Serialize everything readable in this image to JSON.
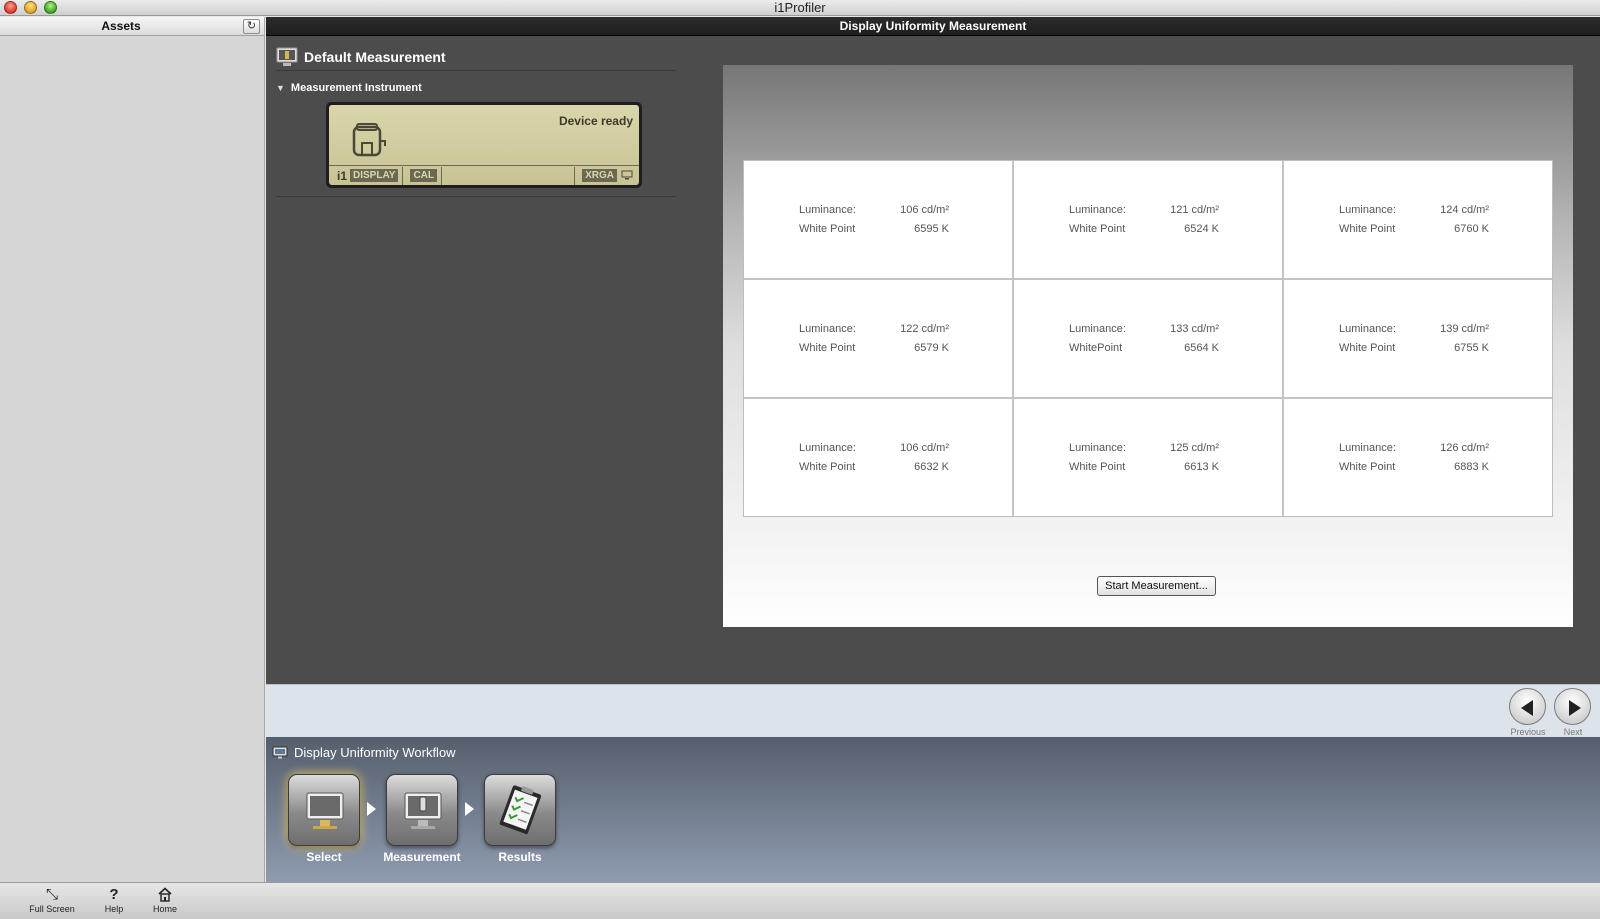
{
  "window": {
    "title": "i1Profiler"
  },
  "sidebar": {
    "title": "Assets",
    "refresh_icon": "↻"
  },
  "main": {
    "header_title": "Display Uniformity Measurement",
    "section_title": "Default Measurement",
    "instrument": {
      "title": "Measurement Instrument",
      "status": "Device ready",
      "tags": [
        "DISPLAY",
        "CAL",
        "XRGA"
      ],
      "logo": "i1"
    },
    "measurements": [
      {
        "lum_label": "Luminance:",
        "lum_value": "106 cd/m²",
        "wp_label": "White Point",
        "wp_value": "6595 K"
      },
      {
        "lum_label": "Luminance:",
        "lum_value": "121 cd/m²",
        "wp_label": "White Point",
        "wp_value": "6524 K"
      },
      {
        "lum_label": "Luminance:",
        "lum_value": "124 cd/m²",
        "wp_label": "White Point",
        "wp_value": "6760 K"
      },
      {
        "lum_label": "Luminance:",
        "lum_value": "122 cd/m²",
        "wp_label": "White Point",
        "wp_value": "6579 K"
      },
      {
        "lum_label": "Luminance:",
        "lum_value": "133 cd/m²",
        "wp_label": "WhitePoint",
        "wp_value": "6564 K"
      },
      {
        "lum_label": "Luminance:",
        "lum_value": "139 cd/m²",
        "wp_label": "White Point",
        "wp_value": "6755 K"
      },
      {
        "lum_label": "Luminance:",
        "lum_value": "106 cd/m²",
        "wp_label": "White Point",
        "wp_value": "6632 K"
      },
      {
        "lum_label": "Luminance:",
        "lum_value": "125 cd/m²",
        "wp_label": "White Point",
        "wp_value": "6613 K"
      },
      {
        "lum_label": "Luminance:",
        "lum_value": "126 cd/m²",
        "wp_label": "White Point",
        "wp_value": "6883 K"
      }
    ],
    "start_button": "Start Measurement..."
  },
  "nav": {
    "previous": "Previous",
    "next": "Next"
  },
  "workflow": {
    "title": "Display Uniformity Workflow",
    "steps": [
      {
        "label": "Select",
        "icon": "monitor-icon",
        "active": true
      },
      {
        "label": "Measurement",
        "icon": "monitor-measure-icon",
        "active": false
      },
      {
        "label": "Results",
        "icon": "clipboard-results-icon",
        "active": false
      }
    ]
  },
  "toolbar": {
    "fullscreen": "Full Screen",
    "help": "Help",
    "home": "Home"
  }
}
